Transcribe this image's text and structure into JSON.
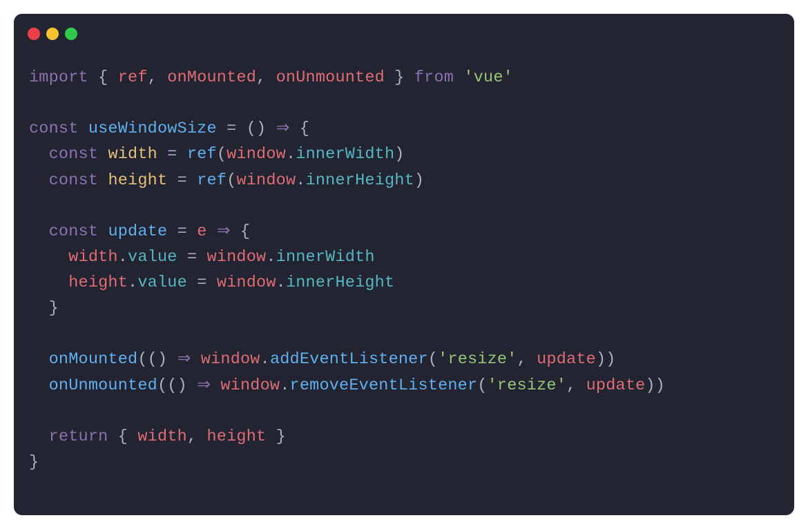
{
  "colors": {
    "bg": "#222531",
    "red": "#ed3e4b",
    "yellow": "#f5c12d",
    "green": "#2fca4b",
    "keyword": "#8d71b0",
    "punct": "#abb2bf",
    "ident": "#e06c75",
    "func": "#61afef",
    "var": "#e5c07b",
    "string": "#98c379",
    "prop": "#56b6c2"
  },
  "code": {
    "line1": {
      "import": "import",
      "lbrace": " { ",
      "ref": "ref",
      "comma1": ", ",
      "onMounted": "onMounted",
      "comma2": ", ",
      "onUnmounted": "onUnmounted",
      "rbrace": " } ",
      "from": "from",
      "space": " ",
      "vue": "'vue'"
    },
    "line3": {
      "const": "const",
      "space1": " ",
      "useWindowSize": "useWindowSize",
      "space2": " ",
      "eq": "=",
      "space3": " ",
      "lparen": "(",
      "rparen": ")",
      "space4": " ",
      "arrow": "⇒",
      "space5": " ",
      "lbrace": "{"
    },
    "line4": {
      "indent": "  ",
      "const": "const",
      "space1": " ",
      "width": "width",
      "space2": " ",
      "eq": "=",
      "space3": " ",
      "ref": "ref",
      "lparen": "(",
      "window": "window",
      "dot": ".",
      "innerWidth": "innerWidth",
      "rparen": ")"
    },
    "line5": {
      "indent": "  ",
      "const": "const",
      "space1": " ",
      "height": "height",
      "space2": " ",
      "eq": "=",
      "space3": " ",
      "ref": "ref",
      "lparen": "(",
      "window": "window",
      "dot": ".",
      "innerHeight": "innerHeight",
      "rparen": ")"
    },
    "line7": {
      "indent": "  ",
      "const": "const",
      "space1": " ",
      "update": "update",
      "space2": " ",
      "eq": "=",
      "space3": " ",
      "e": "e",
      "space4": " ",
      "arrow": "⇒",
      "space5": " ",
      "lbrace": "{"
    },
    "line8": {
      "indent": "    ",
      "width": "width",
      "dot1": ".",
      "value": "value",
      "space1": " ",
      "eq": "=",
      "space2": " ",
      "window": "window",
      "dot2": ".",
      "innerWidth": "innerWidth"
    },
    "line9": {
      "indent": "    ",
      "height": "height",
      "dot1": ".",
      "value": "value",
      "space1": " ",
      "eq": "=",
      "space2": " ",
      "window": "window",
      "dot2": ".",
      "innerHeight": "innerHeight"
    },
    "line10": {
      "indent": "  ",
      "rbrace": "}"
    },
    "line12": {
      "indent": "  ",
      "onMounted": "onMounted",
      "lparen1": "(",
      "lparen2": "(",
      "rparen1": ")",
      "space1": " ",
      "arrow": "⇒",
      "space2": " ",
      "window": "window",
      "dot": ".",
      "addEventListener": "addEventListener",
      "lparen3": "(",
      "resize": "'resize'",
      "comma": ", ",
      "update": "update",
      "rparen2": ")",
      "rparen3": ")"
    },
    "line13": {
      "indent": "  ",
      "onUnmounted": "onUnmounted",
      "lparen1": "(",
      "lparen2": "(",
      "rparen1": ")",
      "space1": " ",
      "arrow": "⇒",
      "space2": " ",
      "window": "window",
      "dot": ".",
      "removeEventListener": "removeEventListener",
      "lparen3": "(",
      "resize": "'resize'",
      "comma": ", ",
      "update": "update",
      "rparen2": ")",
      "rparen3": ")"
    },
    "line15": {
      "indent": "  ",
      "return": "return",
      "space1": " ",
      "lbrace": "{ ",
      "width": "width",
      "comma": ", ",
      "height": "height",
      "rbrace": " }"
    },
    "line16": {
      "rbrace": "}"
    }
  }
}
